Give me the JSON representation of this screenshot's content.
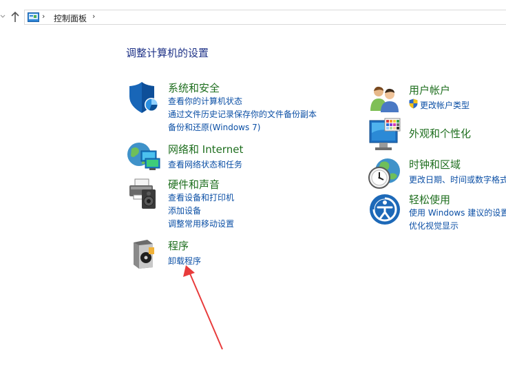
{
  "address_bar": {
    "separator": "›",
    "crumb": "控制面板"
  },
  "heading": "调整计算机的设置",
  "categories": {
    "system_security": {
      "title": "系统和安全",
      "links": [
        "查看你的计算机状态",
        "通过文件历史记录保存你的文件备份副本",
        "备份和还原(Windows 7)"
      ]
    },
    "network": {
      "title": "网络和 Internet",
      "links": [
        "查看网络状态和任务"
      ]
    },
    "hardware_sound": {
      "title": "硬件和声音",
      "links": [
        "查看设备和打印机",
        "添加设备",
        "调整常用移动设置"
      ]
    },
    "programs": {
      "title": "程序",
      "links": [
        "卸载程序"
      ]
    },
    "user_accounts": {
      "title": "用户帐户",
      "links": [
        "更改帐户类型"
      ]
    },
    "appearance": {
      "title": "外观和个性化",
      "links": []
    },
    "clock_region": {
      "title": "时钟和区域",
      "links": [
        "更改日期、时间或数字格式"
      ]
    },
    "ease_of_access": {
      "title": "轻松使用",
      "links": [
        "使用 Windows 建议的设置",
        "优化视觉显示"
      ]
    }
  },
  "colors": {
    "title_green": "#1e6e1e",
    "link_blue": "#0b4fa5",
    "heading_blue": "#1e3287",
    "annotation_red": "#e83b3b"
  }
}
